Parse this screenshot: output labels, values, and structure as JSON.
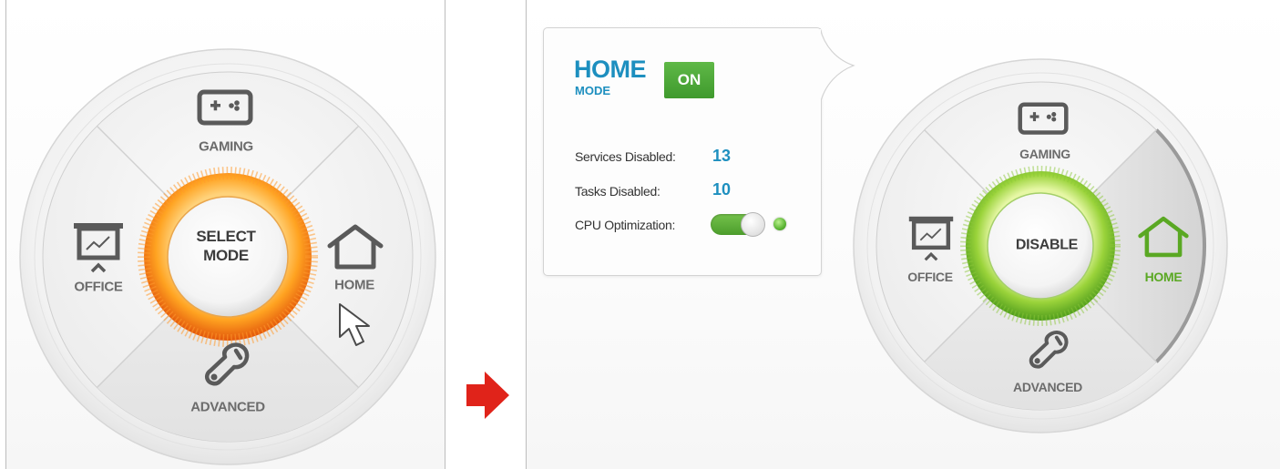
{
  "colors": {
    "accent_blue": "#1d8fbf",
    "active_green": "#5aa823",
    "select_orange": "#f07a12",
    "arrow_red": "#e0231a",
    "on_badge": "#4aa834"
  },
  "left_dial": {
    "center_label_line1": "SELECT",
    "center_label_line2": "MODE",
    "segments": {
      "gaming": {
        "label": "GAMING",
        "icon": "gamepad-icon"
      },
      "office": {
        "label": "OFFICE",
        "icon": "presentation-board-icon"
      },
      "home": {
        "label": "HOME",
        "icon": "house-icon"
      },
      "advanced": {
        "label": "ADVANCED",
        "icon": "wrench-icon"
      }
    },
    "cursor_icon": "mouse-pointer-icon"
  },
  "transition_arrow_icon": "red-arrow-right-icon",
  "info_panel": {
    "mode_name": "HOME",
    "mode_sub": "MODE",
    "status_badge": "ON",
    "stats": [
      {
        "label": "Services Disabled:",
        "value": "13"
      },
      {
        "label": "Tasks Disabled:",
        "value": "10"
      }
    ],
    "cpu_label": "CPU Optimization:",
    "cpu_optimization_on": true
  },
  "right_dial": {
    "center_label": "DISABLE",
    "active_segment": "home",
    "segments": {
      "gaming": {
        "label": "GAMING",
        "icon": "gamepad-icon"
      },
      "office": {
        "label": "OFFICE",
        "icon": "presentation-board-icon"
      },
      "home": {
        "label": "HOME",
        "icon": "house-icon"
      },
      "advanced": {
        "label": "ADVANCED",
        "icon": "wrench-icon"
      }
    }
  }
}
